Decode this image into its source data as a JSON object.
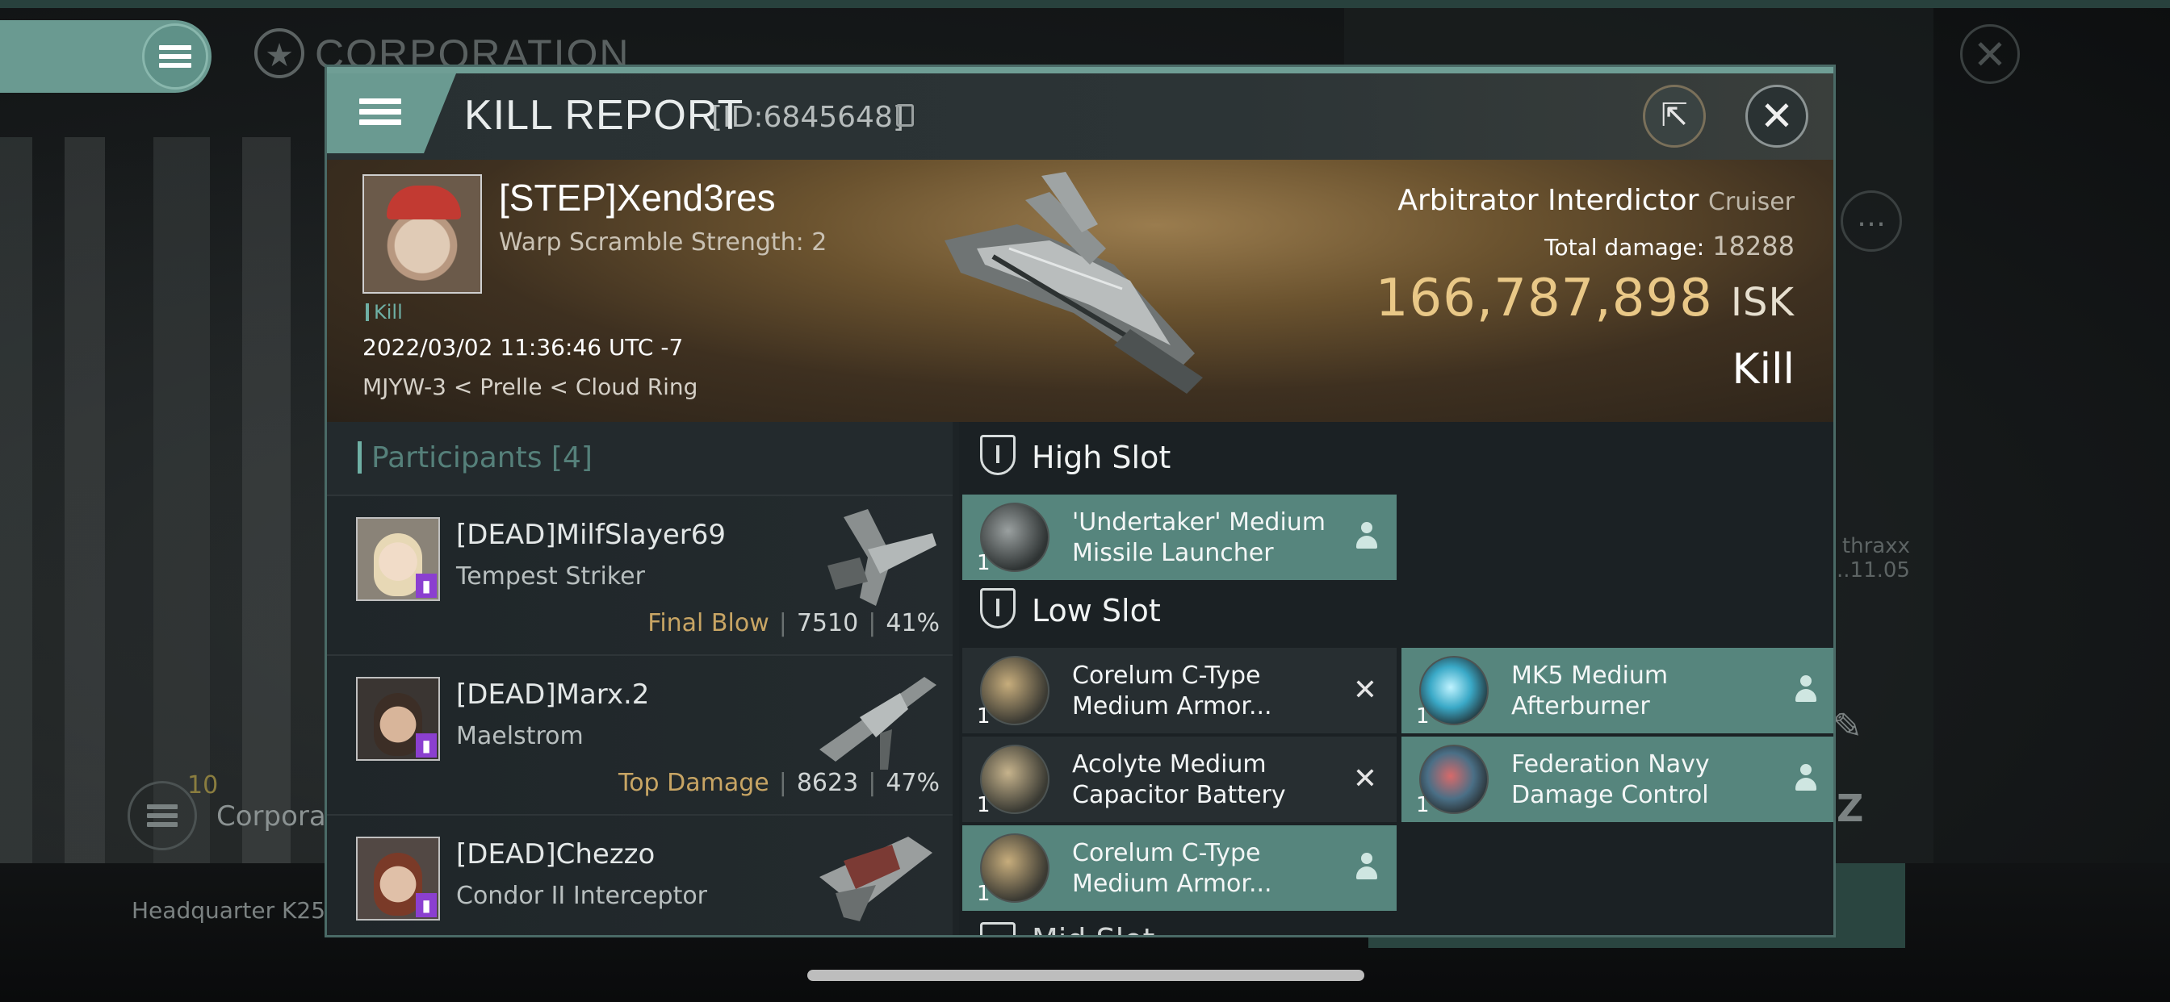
{
  "background": {
    "corporation_title": "CORPORATION",
    "corp_label": "Corpora",
    "corp_count": "10",
    "headquarter_text": "Headquarter K25",
    "side_name": "thraxx",
    "side_date": "..11.05"
  },
  "kill_report": {
    "title": "KILL REPORT",
    "id_text": "[ID:6845648]",
    "victim": {
      "name": "[STEP]Xend3res",
      "warp_scramble": "Warp Scramble Strength: 2",
      "kill_tag": "Kill",
      "datetime": "2022/03/02 11:36:46 UTC -7",
      "location": "MJYW-3 < Prelle < Cloud Ring",
      "ship_name": "Arbitrator Interdictor",
      "ship_class": "Cruiser",
      "total_damage_label": "Total damage:",
      "total_damage": "18288",
      "isk_value": "166,787,898",
      "isk_unit": "ISK",
      "result": "Kill"
    },
    "participants": {
      "title": "Participants",
      "count": "[4]",
      "rows": [
        {
          "name": "[DEAD]MilfSlayer69",
          "ship": "Tempest Striker",
          "tag": "Final Blow",
          "damage": "7510",
          "percent": "41%"
        },
        {
          "name": "[DEAD]Marx.2",
          "ship": "Maelstrom",
          "tag": "Top Damage",
          "damage": "8623",
          "percent": "47%"
        },
        {
          "name": "[DEAD]Chezzo",
          "ship": "Condor II Interceptor",
          "tag": "",
          "damage": "",
          "percent": ""
        }
      ]
    },
    "fitting": {
      "high_slot_title": "High Slot",
      "low_slot_title": "Low Slot",
      "mid_slot_title": "Mid Slot",
      "high": [
        {
          "line1": "'Undertaker' Medium",
          "line2": "Missile Launcher",
          "qty": "1",
          "state": "fitted"
        }
      ],
      "low": [
        {
          "line1": "Corelum C-Type",
          "line2": "Medium Armor...",
          "qty": "1",
          "state": "destroyed"
        },
        {
          "line1": "MK5 Medium",
          "line2": "Afterburner",
          "qty": "1",
          "state": "fitted"
        },
        {
          "line1": "Acolyte Medium",
          "line2": "Capacitor Battery",
          "qty": "1",
          "state": "destroyed"
        },
        {
          "line1": "Federation Navy",
          "line2": "Damage Control",
          "qty": "1",
          "state": "fitted"
        },
        {
          "line1": "Corelum C-Type",
          "line2": "Medium Armor...",
          "qty": "1",
          "state": "fitted"
        }
      ]
    }
  }
}
